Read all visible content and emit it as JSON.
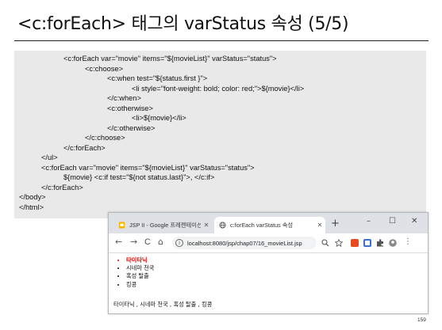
{
  "slide": {
    "title": "<c:forEach> 태그의 varStatus 속성 (5/5)",
    "page_number": "159"
  },
  "code": {
    "lines": [
      "<c:forEach var=\"movie\" items=\"${movieList}\" varStatus=\"status\">",
      "<c:choose>",
      "<c:when test=\"${status.first }\">",
      "<li style=\"font-weight: bold; color: red;\">${movie}</li>",
      "</c:when>",
      "<c:otherwise>",
      "<li>${movie}</li>",
      "</c:otherwise>",
      "</c:choose>",
      "</c:forEach>",
      "</ul>",
      "<c:forEach var=\"movie\" items=\"${movieList}\" varStatus=\"status\">",
      "${movie} <c:if test=\"${not status.last}\">, </c:if>",
      "</c:forEach>",
      "</body>",
      "</html>"
    ]
  },
  "browser": {
    "tabs": [
      {
        "label": "JSP II - Google 프레젠테이션",
        "icon": "slides-icon",
        "active": false
      },
      {
        "label": "c:forEach varStatus 속성",
        "icon": "globe-icon",
        "active": true
      }
    ],
    "new_tab": "+",
    "window_controls": {
      "minimize": "–",
      "maximize": "☐",
      "close": "✕"
    },
    "nav": {
      "back": "←",
      "forward": "→",
      "reload": "C",
      "home": "⌂"
    },
    "url": "localhost:8080/jsp/chap07/16_movieList.jsp",
    "page": {
      "movies": [
        "타이타닉",
        "시네마 천국",
        "혹성 탈출",
        "킹콩"
      ],
      "joined": "타이타닉 , 시네마 천국 , 혹성 탈출 , 킹콩"
    },
    "colors": {
      "first_item": "#e00000",
      "tabbar": "#dee1e6"
    }
  }
}
